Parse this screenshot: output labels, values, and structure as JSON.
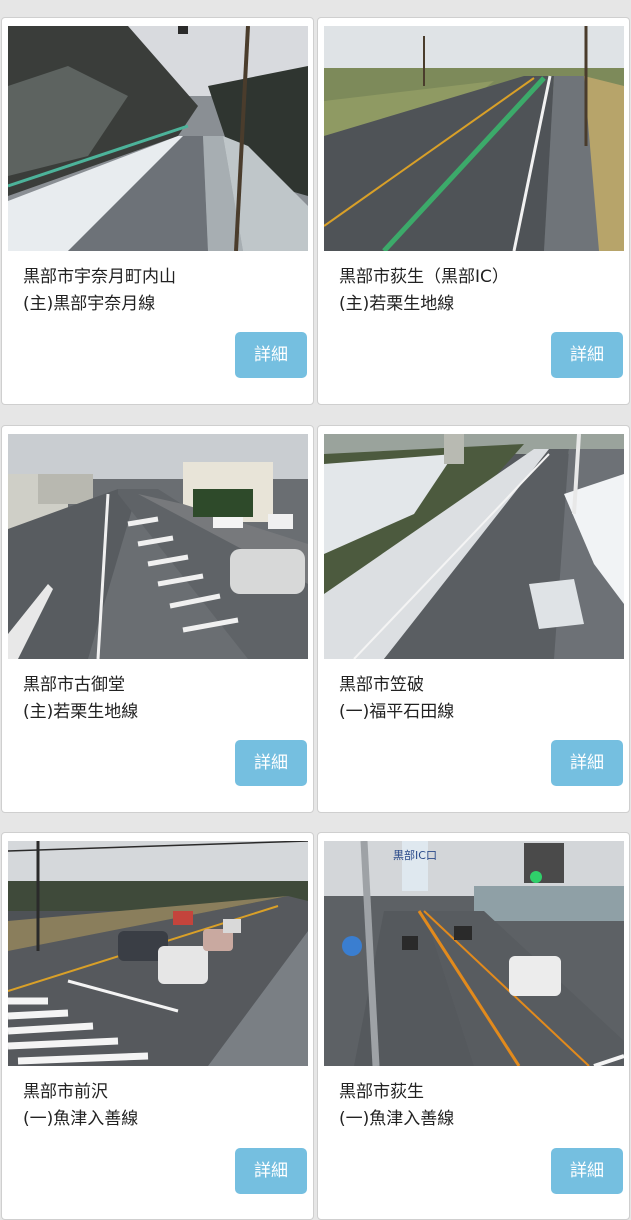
{
  "cameras": [
    {
      "place": "黒部市宇奈月町内山",
      "road": "(主)黒部宇奈月線",
      "button": "詳細"
    },
    {
      "place": "黒部市荻生（黒部IC）",
      "road": "(主)若栗生地線",
      "button": "詳細"
    },
    {
      "place": "黒部市古御堂",
      "road": "(主)若栗生地線",
      "button": "詳細"
    },
    {
      "place": "黒部市笠破",
      "road": "(一)福平石田線",
      "button": "詳細"
    },
    {
      "place": "黒部市前沢",
      "road": "(一)魚津入善線",
      "button": "詳細"
    },
    {
      "place": "黒部市荻生",
      "road": "(一)魚津入善線",
      "button": "詳細"
    }
  ],
  "overlay_signs": {
    "ic_sign": "黒部IC口"
  },
  "colors": {
    "button": "#75bfe0",
    "page_background": "#e6e6e6"
  }
}
